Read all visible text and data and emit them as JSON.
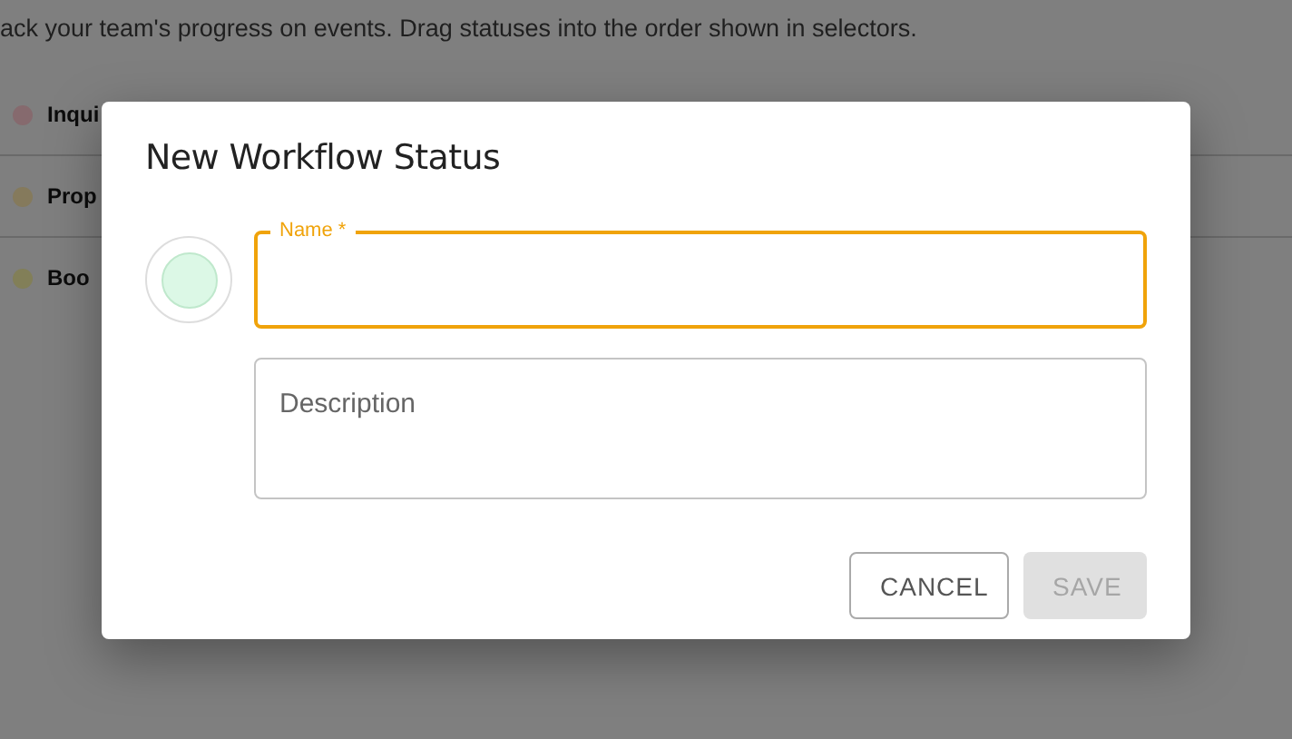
{
  "page": {
    "description": "ack your team's progress on events. Drag statuses into the order shown in selectors.",
    "statuses": [
      {
        "name": "Inqui",
        "color": "#866a6e"
      },
      {
        "name": "Prop",
        "color": "#857a5c"
      },
      {
        "name": "Boo",
        "color": "#827f58"
      }
    ]
  },
  "dialog": {
    "title": "New Workflow Status",
    "fields": [
      {
        "label": "Name *",
        "focused": true,
        "multiline": false
      },
      {
        "placeholder": "Description",
        "focused": false,
        "multiline": true
      }
    ],
    "buttons": [
      {
        "label": "CANCEL",
        "disabled": false,
        "kind": "outlined"
      },
      {
        "label": "SAVE",
        "disabled": true,
        "kind": "contained"
      }
    ]
  }
}
